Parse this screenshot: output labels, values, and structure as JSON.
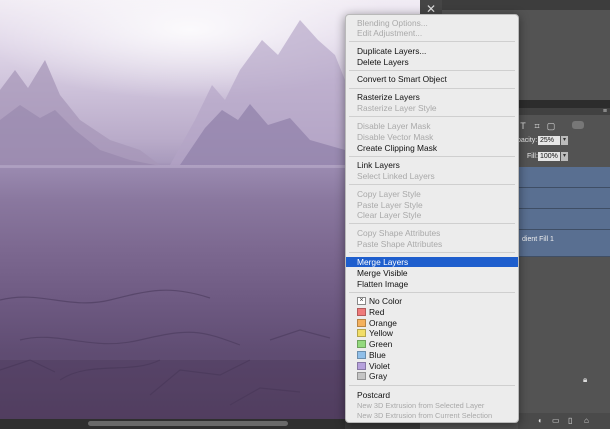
{
  "context_menu": {
    "items": {
      "blending_options": "Blending Options...",
      "edit_adjustment": "Edit Adjustment...",
      "duplicate_layers": "Duplicate Layers...",
      "delete_layers": "Delete Layers",
      "convert_smart_object": "Convert to Smart Object",
      "rasterize_layers": "Rasterize Layers",
      "rasterize_layer_style": "Rasterize Layer Style",
      "disable_layer_mask": "Disable Layer Mask",
      "disable_vector_mask": "Disable Vector Mask",
      "create_clipping_mask": "Create Clipping Mask",
      "link_layers": "Link Layers",
      "select_linked_layers": "Select Linked Layers",
      "copy_layer_style": "Copy Layer Style",
      "paste_layer_style": "Paste Layer Style",
      "clear_layer_style": "Clear Layer Style",
      "copy_shape_attributes": "Copy Shape Attributes",
      "paste_shape_attributes": "Paste Shape Attributes",
      "merge_layers": "Merge Layers",
      "merge_visible": "Merge Visible",
      "flatten_image": "Flatten Image",
      "postcard": "Postcard",
      "new_3d_selected": "New 3D Extrusion from Selected Layer",
      "new_3d_current": "New 3D Extrusion from Current Selection"
    },
    "colors": [
      {
        "label": "No Color",
        "hex": "#ffffff"
      },
      {
        "label": "Red",
        "hex": "#ef7a7a"
      },
      {
        "label": "Orange",
        "hex": "#f4b15e"
      },
      {
        "label": "Yellow",
        "hex": "#f1dd67"
      },
      {
        "label": "Green",
        "hex": "#93d97d"
      },
      {
        "label": "Blue",
        "hex": "#90bfe9"
      },
      {
        "label": "Violet",
        "hex": "#b6a1dc"
      },
      {
        "label": "Gray",
        "hex": "#c4c4c4"
      }
    ],
    "highlight_color": "#1e5ecd"
  },
  "layers_panel": {
    "opacity_label": "pacity:",
    "opacity_value": "25%",
    "fill_label": "Fill:",
    "fill_value": "100%",
    "layer_label": "dient Fill 1"
  }
}
